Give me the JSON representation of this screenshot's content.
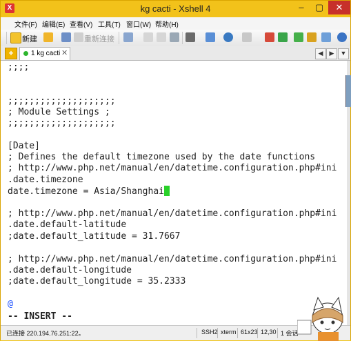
{
  "window": {
    "title": "kg cacti - Xshell 4",
    "controls": {
      "minimize": "–",
      "maximize": "▢",
      "close": "✕"
    }
  },
  "menu": [
    "文件(F)",
    "编辑(E)",
    "查看(V)",
    "工具(T)",
    "窗口(W)",
    "帮助(H)"
  ],
  "toolbar": {
    "new_label": "新建",
    "reconnect_label": "重新连接"
  },
  "tabs": {
    "add": "+",
    "active_label": "1 kg cacti",
    "close": "✕",
    "nav": [
      "◀",
      "▶",
      "▼"
    ]
  },
  "terminal": {
    "lines": [
      ";;;;",
      "",
      "",
      ";;;;;;;;;;;;;;;;;;;;",
      "; Module Settings ;",
      ";;;;;;;;;;;;;;;;;;;;",
      "",
      "[Date]",
      "; Defines the default timezone used by the date functions",
      "; http://www.php.net/manual/en/datetime.configuration.php#ini",
      ".date.timezone",
      "date.timezone = Asia/Shanghai",
      "",
      "; http://www.php.net/manual/en/datetime.configuration.php#ini",
      ".date.default-latitude",
      ";date.default_latitude = 31.7667",
      "",
      "; http://www.php.net/manual/en/datetime.configuration.php#ini",
      ".date.default-longitude",
      ";date.default_longitude = 35.2333",
      "",
      "@",
      "-- INSERT --"
    ],
    "cursor_line_index": 11
  },
  "status": {
    "connection": "已连接 220.194.76.251:22。",
    "protocol": "SSH2",
    "terminal_type": "xterm",
    "size": "61x23",
    "cursor_pos": "12,30",
    "sessions": "1 会话"
  },
  "colors": {
    "title_bar": "#f2c21a",
    "close_button": "#c7302a",
    "cursor": "#2ad12a",
    "at_sign": "#1b4fff"
  }
}
